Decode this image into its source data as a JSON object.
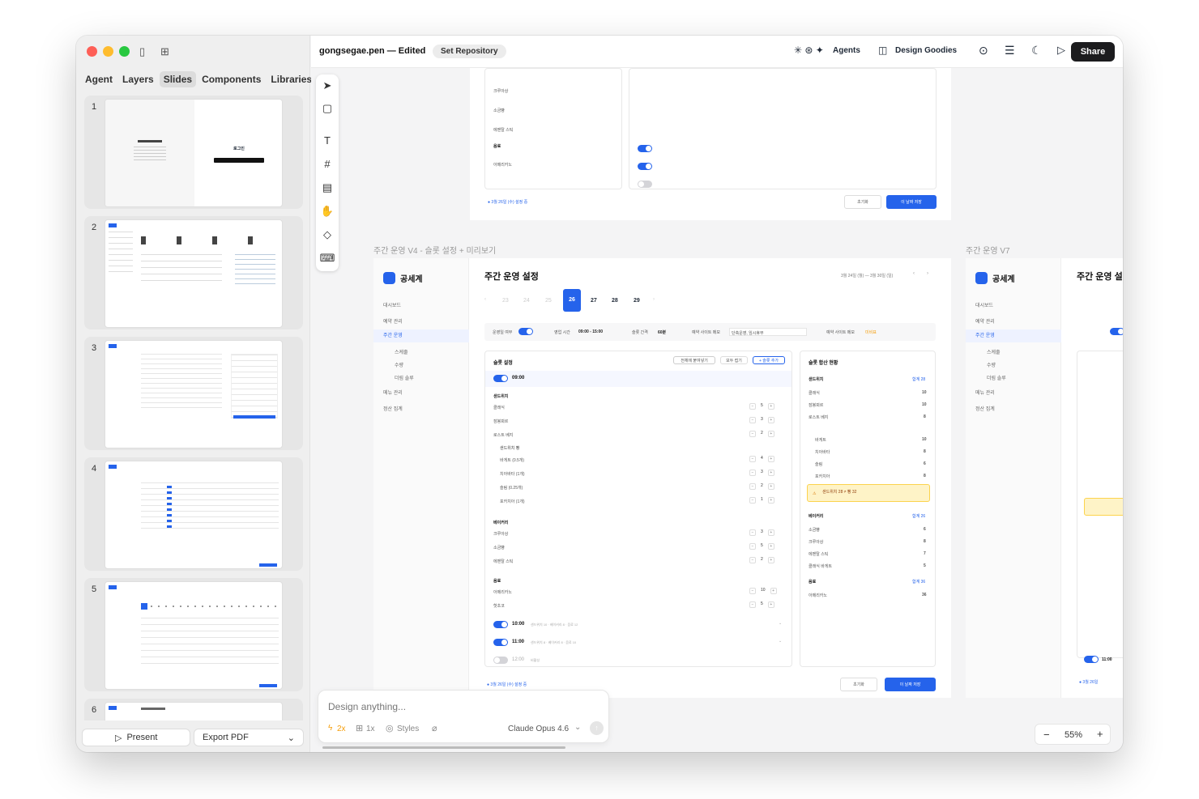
{
  "sidebar": {
    "tabs": [
      "Agent",
      "Layers",
      "Slides",
      "Components",
      "Libraries"
    ],
    "active_tab": "Slides",
    "slides": [
      {
        "num": "1",
        "title": "로그인"
      },
      {
        "num": "2"
      },
      {
        "num": "3"
      },
      {
        "num": "4"
      },
      {
        "num": "5"
      },
      {
        "num": "6"
      }
    ],
    "present_label": "Present",
    "export_label": "Export PDF"
  },
  "topbar": {
    "filename": "gongsegae.pen — Edited",
    "set_repo": "Set Repository",
    "agents": "Agents",
    "design_goodies": "Design Goodies",
    "share": "Share"
  },
  "canvas": {
    "frame_v4_label": "주간 운영 V4 - 슬롯 설정 + 미리보기",
    "frame_v7_label": "주간 운영 V7",
    "brand": "공세계",
    "menu": [
      "대시보드",
      "예약 관리",
      "주간 운영",
      "스케줄",
      "수량",
      "더림 솔루",
      "메뉴 관리",
      "정산 집계"
    ],
    "page_title": "주간 운영 설정",
    "date_range": "3월 24일 (월) — 3월 30일 (일)",
    "days": [
      "23",
      "24",
      "25",
      "26",
      "27",
      "28",
      "29"
    ],
    "settings": {
      "op_label": "운영일 여부",
      "hours_label": "영업 시간",
      "hours": "09:00 - 15:00",
      "slot_label": "슬롯 간격",
      "slot": "60분",
      "site_label": "예약 사이트 메모",
      "site": "단축운영, 임시휴무",
      "site2_label": "예약 사이트 메모",
      "site2": "미비표"
    },
    "slot_panel": {
      "title": "슬롯 설정",
      "btn1": "전체에 붙여넣기",
      "btn2": "모두 접기",
      "btn3": "+ 슬롯 추가",
      "time1": "09:00",
      "groups": [
        {
          "name": "샌드위치",
          "items": [
            {
              "n": "클래식",
              "v": "5"
            },
            {
              "n": "잠봉뵈르",
              "v": "3"
            },
            {
              "n": "로스트 베지",
              "v": "2"
            }
          ]
        },
        {
          "name": "샌드위치 빵",
          "items": [
            {
              "n": "바게트 (0.5개)",
              "v": "4"
            },
            {
              "n": "치아바타 (1개)",
              "v": "3"
            },
            {
              "n": "슬림 (0.25개)",
              "v": "2"
            },
            {
              "n": "포카치아 (1개)",
              "v": "1"
            }
          ]
        },
        {
          "name": "베이커리",
          "items": [
            {
              "n": "크루아상",
              "v": "3"
            },
            {
              "n": "소금빵",
              "v": "5"
            },
            {
              "n": "에멘탈 스틱",
              "v": "2"
            }
          ]
        },
        {
          "name": "음료",
          "items": [
            {
              "n": "아메리카노",
              "v": "10"
            },
            {
              "n": "핫초코",
              "v": "5"
            }
          ]
        }
      ],
      "time2": "10:00",
      "time2_note": "샌드위치 10 · 베이커리 8 · 음료 12",
      "time3": "11:00",
      "time3_note": "샌드위치 8 · 베이커리 8 · 음료 10",
      "time4": "12:00",
      "time4_note": "비활성"
    },
    "summary_panel": {
      "title": "슬롯 합산 현황",
      "sections": [
        {
          "name": "샌드위치",
          "total": "합계 28",
          "items": [
            {
              "n": "클래식",
              "v": "10"
            },
            {
              "n": "잠봉뵈르",
              "v": "10"
            },
            {
              "n": "로스트 베지",
              "v": "8"
            },
            {
              "n": "바게트",
              "v": "10"
            },
            {
              "n": "치아바타",
              "v": "8"
            },
            {
              "n": "슬림",
              "v": "6"
            },
            {
              "n": "포카치아",
              "v": "8"
            }
          ]
        },
        {
          "name": "베이커리",
          "total": "합계 26",
          "items": [
            {
              "n": "소금빵",
              "v": "6"
            },
            {
              "n": "크루아상",
              "v": "8"
            },
            {
              "n": "에멘탈 스틱",
              "v": "7"
            },
            {
              "n": "클래식 바게트",
              "v": "5"
            }
          ]
        },
        {
          "name": "음료",
          "total": "합계 36",
          "items": [
            {
              "n": "아메리카노",
              "v": "36"
            }
          ]
        }
      ],
      "warn": "샌드위치 28 ≠ 빵 32"
    },
    "footer_tag": "3월 26일 (수) 설정 중",
    "reset": "초기화",
    "save": "이 날짜 저장"
  },
  "chat": {
    "placeholder": "Design anything...",
    "opt1": "2x",
    "opt2": "1x",
    "opt3": "Styles",
    "model": "Claude Opus 4.6"
  },
  "zoom": {
    "value": "55%"
  },
  "colors": {
    "accent": "#2563eb",
    "share": "#1c1c1e",
    "warn": "#fef3c7"
  }
}
